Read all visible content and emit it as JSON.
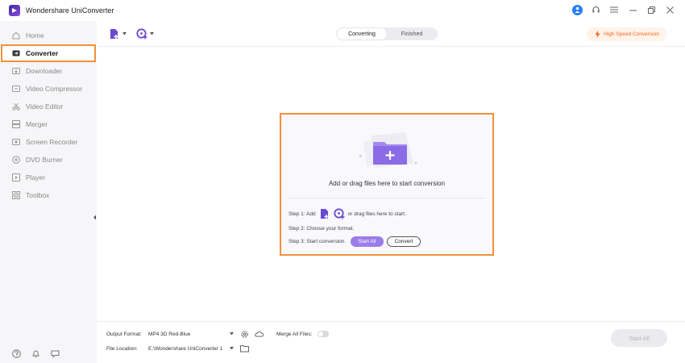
{
  "app": {
    "title": "Wondershare UniConverter",
    "accent": "#8a4bdc",
    "highlight": "#f0913a"
  },
  "sidebar": {
    "items": [
      {
        "label": "Home",
        "icon": "home-icon"
      },
      {
        "label": "Converter",
        "icon": "converter-icon"
      },
      {
        "label": "Downloader",
        "icon": "downloader-icon"
      },
      {
        "label": "Video Compressor",
        "icon": "compress-icon"
      },
      {
        "label": "Video Editor",
        "icon": "scissors-icon"
      },
      {
        "label": "Merger",
        "icon": "merge-icon"
      },
      {
        "label": "Screen Recorder",
        "icon": "record-icon"
      },
      {
        "label": "DVD Burner",
        "icon": "disc-icon"
      },
      {
        "label": "Player",
        "icon": "play-icon"
      },
      {
        "label": "Toolbox",
        "icon": "grid-icon"
      }
    ],
    "active_index": 1
  },
  "tabs": {
    "converting": "Converting",
    "finished": "Finished",
    "active": "converting"
  },
  "toolbar": {
    "high_speed": "High Speed Conversion"
  },
  "dropzone": {
    "main_text": "Add or drag files here to start conversion",
    "step1_prefix": "Step 1: Add",
    "step1_suffix": "or drag files here to start.",
    "step2": "Step 2: Choose your format.",
    "step3": "Step 3: Start conversion.",
    "start_all": "Start All",
    "convert": "Convert"
  },
  "footer": {
    "output_format_label": "Output Format:",
    "output_format_value": "MP4 3D Red-Blue",
    "merge_label": "Merge All Files:",
    "file_location_label": "File Location:",
    "file_location_value": "E:\\Wondershare UniConverter 1",
    "start_all": "Start All"
  }
}
